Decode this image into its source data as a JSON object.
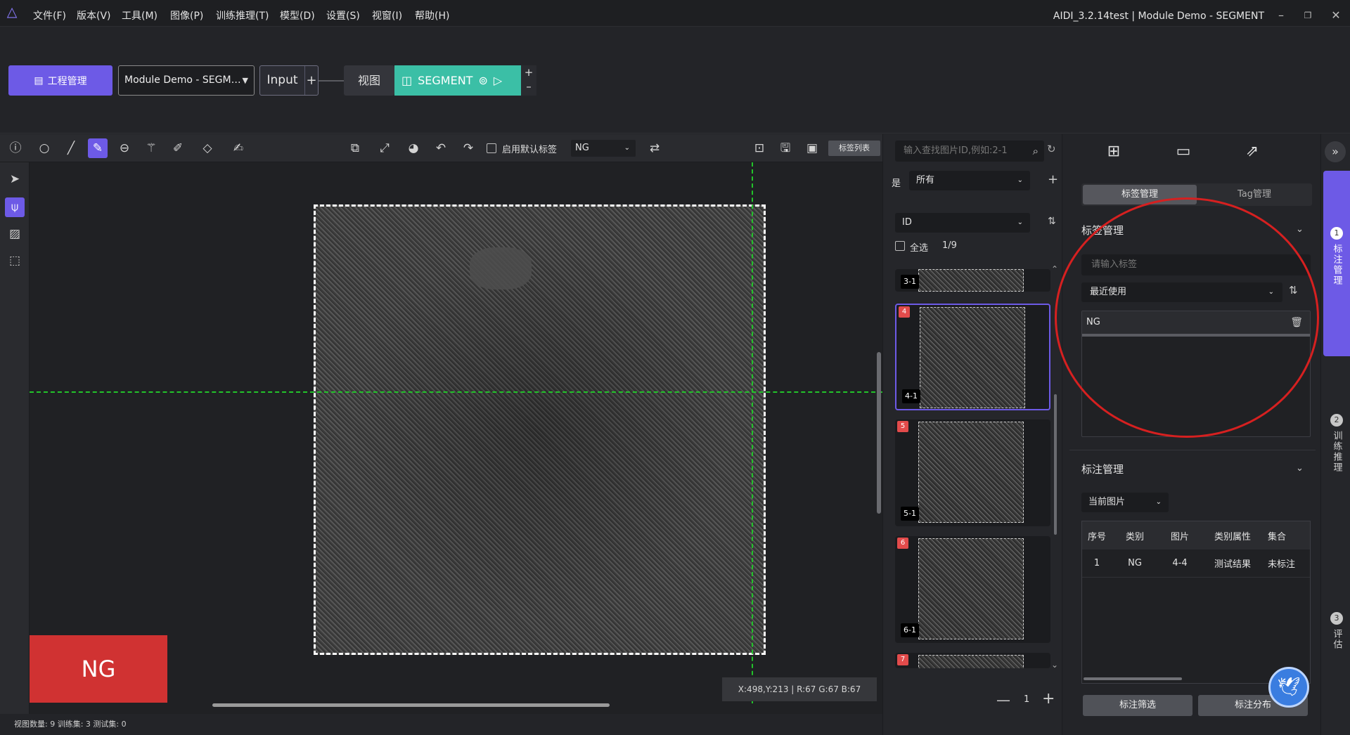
{
  "app": {
    "window_title": "AIDI_3.2.14test | Module Demo - SEGMENT"
  },
  "menu": [
    "文件(F)",
    "版本(V)",
    "工具(M)",
    "图像(P)",
    "训练推理(T)",
    "模型(D)",
    "设置(S)",
    "视窗(I)",
    "帮助(H)"
  ],
  "project": {
    "manage_label": "工程管理",
    "module_selected": "Module Demo - SEGM…",
    "input_label": "Input",
    "view_label": "视图",
    "segment_label": "SEGMENT"
  },
  "toolbar": {
    "default_label_text": "启用默认标签",
    "default_label_value": "NG",
    "labels_list": "标签列表"
  },
  "canvas": {
    "result_badge": "NG",
    "coords": "X:498,Y:213 | R:67 G:67 B:67"
  },
  "status": {
    "text": "视图数量:  9   训练集:  3   测试集:  0"
  },
  "image_list": {
    "search_placeholder": "输入查找图片ID,例如:2-1",
    "filter_label": "是",
    "filter_value": "所有",
    "sort_value": "ID",
    "select_all": "全选",
    "count": "1/9",
    "page": "1",
    "items": [
      {
        "num": "",
        "name": "3-1"
      },
      {
        "num": "4",
        "name": "4-1"
      },
      {
        "num": "5",
        "name": "5-1"
      },
      {
        "num": "6",
        "name": "6-1"
      },
      {
        "num": "7",
        "name": ""
      }
    ]
  },
  "right_panel": {
    "tab_label_mgmt": "标签管理",
    "tab_tag_mgmt": "Tag管理",
    "label_section_title": "标签管理",
    "label_input_placeholder": "请输入标签",
    "recent_select": "最近使用",
    "labels": [
      "NG"
    ],
    "annotation_section_title": "标注管理",
    "annotation_scope": "当前图片",
    "table_headers": [
      "序号",
      "类别",
      "图片",
      "类别属性",
      "集合"
    ],
    "table_rows": [
      [
        "1",
        "NG",
        "4-4",
        "测试结果",
        "未标注"
      ]
    ],
    "filter_button": "标注筛选",
    "distribution_button": "标注分布"
  },
  "rail": {
    "step1_num": "1",
    "step1_text": "标注管理",
    "step2_num": "2",
    "step2_text": "训练推理",
    "step3_num": "3",
    "step3_text": "评估"
  },
  "colors": {
    "accent": "#6d5ae6",
    "segment": "#3bbfa6",
    "ng": "#d03232",
    "guide": "#22c32a"
  }
}
